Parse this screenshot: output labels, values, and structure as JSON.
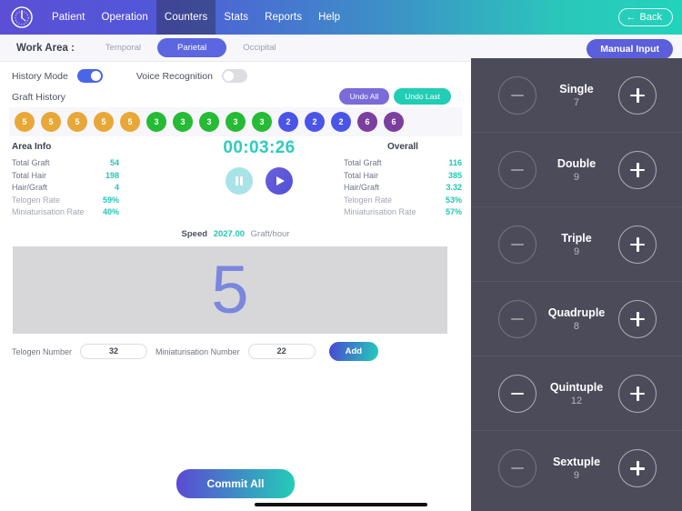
{
  "topnav": {
    "logo_icon": "stopwatch-logo-icon",
    "items": [
      {
        "label": "Patient",
        "active": false
      },
      {
        "label": "Operation",
        "active": false
      },
      {
        "label": "Counters",
        "active": true
      },
      {
        "label": "Stats",
        "active": false
      },
      {
        "label": "Reports",
        "active": false
      },
      {
        "label": "Help",
        "active": false
      }
    ],
    "back_label": "Back",
    "back_arrow": "←",
    "gradient_from": "#5b4fd6",
    "gradient_to": "#22d3bb"
  },
  "workbar": {
    "label": "Work Area :",
    "tabs": [
      {
        "label": "Temporal",
        "active": false
      },
      {
        "label": "Parietal",
        "active": true
      },
      {
        "label": "Occipital",
        "active": false
      }
    ],
    "manual_input_label": "Manual Input",
    "active_tab_color": "#5b66e0"
  },
  "toggles": [
    {
      "label": "History Mode",
      "state": "on"
    },
    {
      "label": "Voice Recognition",
      "state": "off"
    }
  ],
  "graft_history": {
    "label": "Graft History",
    "undo_all_label": "Undo All",
    "undo_last_label": "Undo Last",
    "undo_all_color": "#7b6ad9",
    "undo_last_color": "#22cdb6",
    "chips": [
      {
        "value": "5",
        "color": "#e8a838"
      },
      {
        "value": "5",
        "color": "#e8a838"
      },
      {
        "value": "5",
        "color": "#e8a838"
      },
      {
        "value": "5",
        "color": "#e8a838"
      },
      {
        "value": "5",
        "color": "#e8a838"
      },
      {
        "value": "3",
        "color": "#25bb35"
      },
      {
        "value": "3",
        "color": "#25bb35"
      },
      {
        "value": "3",
        "color": "#25bb35"
      },
      {
        "value": "3",
        "color": "#25bb35"
      },
      {
        "value": "3",
        "color": "#25bb35"
      },
      {
        "value": "2",
        "color": "#4a55e8"
      },
      {
        "value": "2",
        "color": "#4a55e8"
      },
      {
        "value": "2",
        "color": "#4a55e8"
      },
      {
        "value": "6",
        "color": "#7c3f9e"
      },
      {
        "value": "6",
        "color": "#7c3f9e"
      }
    ]
  },
  "area_info": {
    "title": "Area Info",
    "rows": [
      {
        "label": "Total Graft",
        "value": "54",
        "dim": false
      },
      {
        "label": "Total Hair",
        "value": "198",
        "dim": false
      },
      {
        "label": "Hair/Graft",
        "value": "4",
        "dim": false
      },
      {
        "label": "Telogen Rate",
        "value": "59%",
        "dim": true
      },
      {
        "label": "Miniaturisation Rate",
        "value": "40%",
        "dim": true
      }
    ]
  },
  "overall": {
    "title": "Overall",
    "rows": [
      {
        "label": "Total Graft",
        "value": "116",
        "dim": false
      },
      {
        "label": "Total Hair",
        "value": "385",
        "dim": false
      },
      {
        "label": "Hair/Graft",
        "value": "3.32",
        "dim": false
      },
      {
        "label": "Telogen Rate",
        "value": "53%",
        "dim": true
      },
      {
        "label": "Miniaturisation Rate",
        "value": "57%",
        "dim": true
      }
    ]
  },
  "timer": {
    "value": "00:03:26",
    "color": "#2ccdbd",
    "pause_icon": "pause-icon",
    "play_icon": "play-icon"
  },
  "speed": {
    "label": "Speed",
    "value": "2027.00",
    "unit": "Graft/hour"
  },
  "big_display": {
    "value": "5",
    "color": "#7b87dc"
  },
  "input_row": {
    "telogen_label": "Telogen Number",
    "telogen_value": "32",
    "mini_label": "Miniaturisation Number",
    "mini_value": "22",
    "add_label": "Add"
  },
  "commit": {
    "label": "Commit All"
  },
  "counters": [
    {
      "name": "Single",
      "value": "7",
      "minus_bright": false
    },
    {
      "name": "Double",
      "value": "9",
      "minus_bright": false
    },
    {
      "name": "Triple",
      "value": "9",
      "minus_bright": false
    },
    {
      "name": "Quadruple",
      "value": "8",
      "minus_bright": false
    },
    {
      "name": "Quintuple",
      "value": "12",
      "minus_bright": true
    },
    {
      "name": "Sextuple",
      "value": "9",
      "minus_bright": false
    }
  ]
}
